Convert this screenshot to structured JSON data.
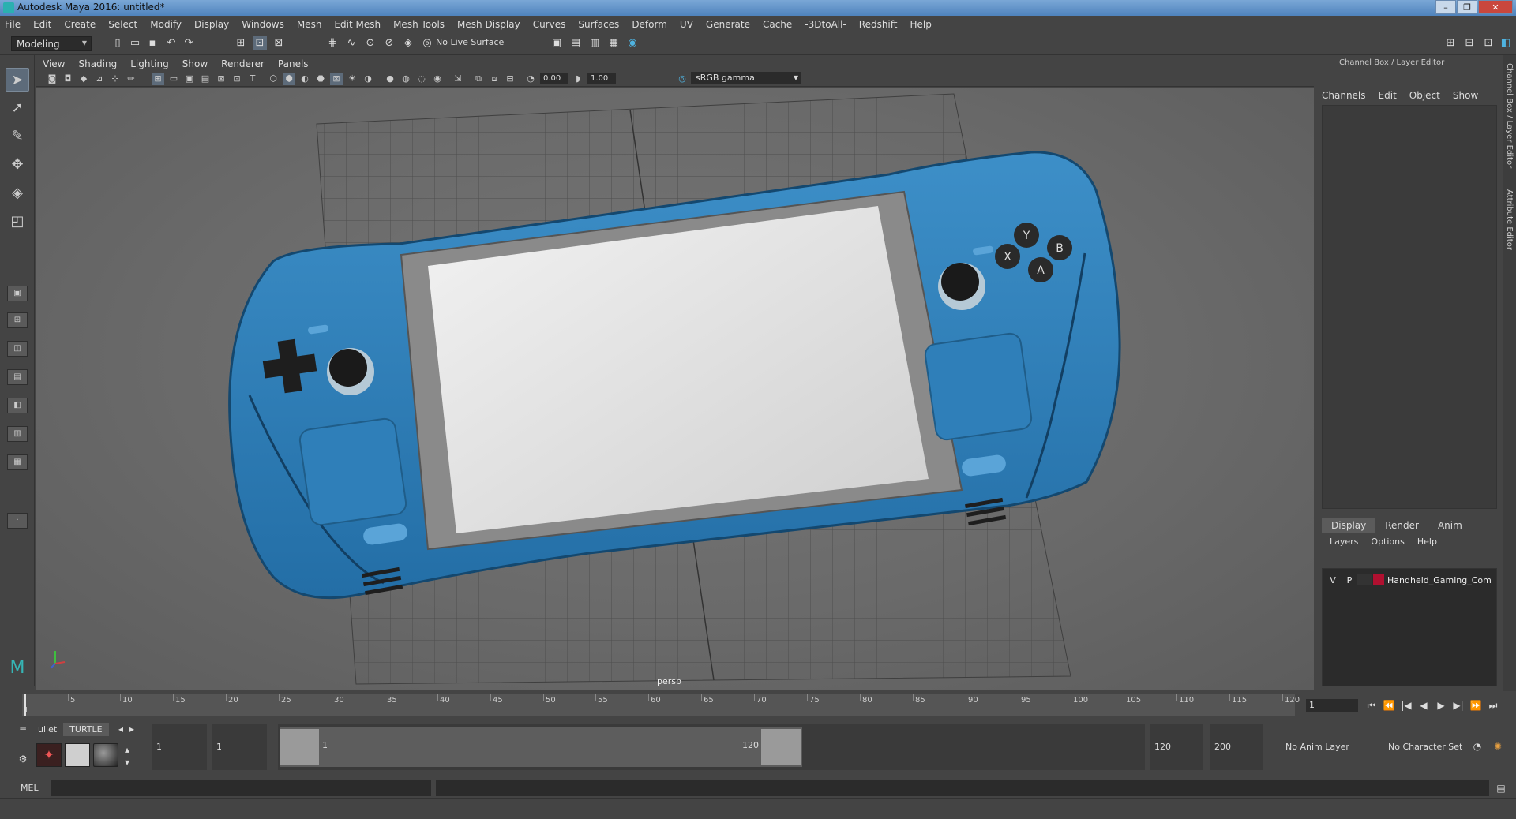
{
  "window": {
    "title": "Autodesk Maya 2016: untitled*",
    "controls": [
      "–",
      "❐",
      "✕"
    ]
  },
  "menu": [
    "File",
    "Edit",
    "Create",
    "Select",
    "Modify",
    "Display",
    "Windows",
    "Mesh",
    "Edit Mesh",
    "Mesh Tools",
    "Mesh Display",
    "Curves",
    "Surfaces",
    "Deform",
    "UV",
    "Generate",
    "Cache",
    "-3DtoAll-",
    "Redshift",
    "Help"
  ],
  "shelf": {
    "mode": "Modeling",
    "live_surface": "No Live Surface"
  },
  "viewport": {
    "menu": [
      "View",
      "Shading",
      "Lighting",
      "Show",
      "Renderer",
      "Panels"
    ],
    "exposure": "0.00",
    "gamma_value": "1.00",
    "colorspace": "sRGB gamma",
    "camera_label": "persp",
    "device_buttons": [
      "Y",
      "X",
      "B",
      "A"
    ]
  },
  "channel_box": {
    "title": "Channel Box / Layer Editor",
    "menu": [
      "Channels",
      "Edit",
      "Object",
      "Show"
    ],
    "side_tabs": [
      "Channel Box / Layer Editor",
      "Attribute Editor"
    ]
  },
  "layer_editor": {
    "tabs": [
      "Display",
      "Render",
      "Anim"
    ],
    "menu": [
      "Layers",
      "Options",
      "Help"
    ],
    "layers": [
      {
        "v": "V",
        "p": "P",
        "name": "Handheld_Gaming_Com",
        "color": "#b01030"
      }
    ]
  },
  "timeline": {
    "start_label": "1",
    "ticks": [
      "5",
      "10",
      "15",
      "20",
      "25",
      "30",
      "35",
      "40",
      "45",
      "50",
      "55",
      "60",
      "65",
      "70",
      "75",
      "80",
      "85",
      "90",
      "95",
      "100",
      "105",
      "110",
      "115",
      "120"
    ],
    "current_frame": "1"
  },
  "range": {
    "shelf_tabs": [
      "ullet",
      "TURTLE"
    ],
    "start": "1",
    "playback_start": "1",
    "slider_start_label": "1",
    "slider_end_label": "120",
    "playback_end": "120",
    "end": "200",
    "anim_layer": "No Anim Layer",
    "character_set": "No Character Set"
  },
  "command_line": {
    "label": "MEL"
  }
}
